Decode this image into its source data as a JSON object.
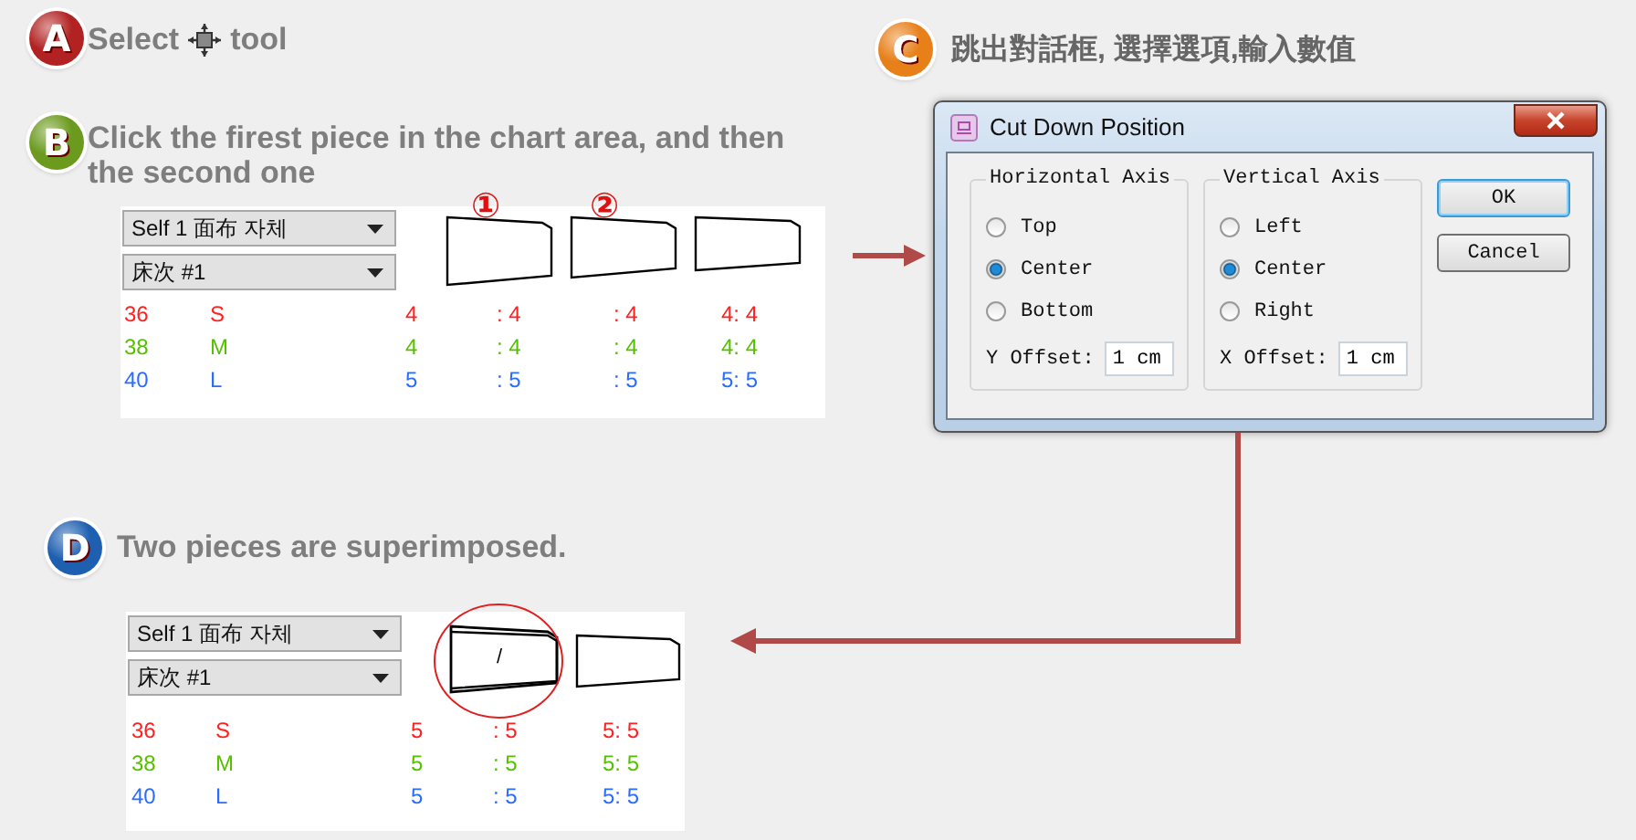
{
  "steps": [
    {
      "badge": "A",
      "color": "#b22222",
      "kind": "tool",
      "text_before": "Select",
      "text_after": "tool"
    },
    {
      "badge": "C",
      "color": "#e8801a",
      "kind": "text",
      "text": "跳出對話框, 選擇選項,輸入數值"
    },
    {
      "badge": "B",
      "color": "#6b9a1e",
      "kind": "text",
      "text": "Click the firest piece in the chart area, and then the second one"
    },
    {
      "badge": "D",
      "color": "#1f5fb0",
      "kind": "text",
      "text": "Two pieces are superimposed."
    }
  ],
  "markers": [
    "①",
    "②"
  ],
  "before_panel": {
    "dropdowns": [
      "Self 1 面布 자체",
      "床次 #1"
    ],
    "rows": [
      {
        "size": "36",
        "name": "S",
        "color": "#ff2020",
        "cells": [
          "4",
          ": 4",
          ": 4",
          "4: 4"
        ]
      },
      {
        "size": "38",
        "name": "M",
        "color": "#55c000",
        "cells": [
          "4",
          ": 4",
          ": 4",
          "4: 4"
        ]
      },
      {
        "size": "40",
        "name": "L",
        "color": "#2a6cff",
        "cells": [
          "5",
          ": 5",
          ": 5",
          "5: 5"
        ]
      }
    ]
  },
  "dialog": {
    "title": "Cut Down Position",
    "groups": [
      {
        "title": "Horizontal Axis",
        "options": [
          {
            "label": "Top",
            "selected": false
          },
          {
            "label": "Center",
            "selected": true
          },
          {
            "label": "Bottom",
            "selected": false
          }
        ],
        "offset_label": "Y Offset:",
        "offset_value": "1 cm"
      },
      {
        "title": "Vertical Axis",
        "options": [
          {
            "label": "Left",
            "selected": false
          },
          {
            "label": "Center",
            "selected": true
          },
          {
            "label": "Right",
            "selected": false
          }
        ],
        "offset_label": "X Offset:",
        "offset_value": "1 cm"
      }
    ],
    "buttons": [
      {
        "label": "OK",
        "default": true
      },
      {
        "label": "Cancel",
        "default": false
      }
    ]
  },
  "after_panel": {
    "dropdowns": [
      "Self 1 面布 자체",
      "床次 #1"
    ],
    "mark": "/",
    "rows": [
      {
        "size": "36",
        "name": "S",
        "color": "#ff2020",
        "cells": [
          "5",
          ": 5",
          "5: 5"
        ]
      },
      {
        "size": "38",
        "name": "M",
        "color": "#55c000",
        "cells": [
          "5",
          ": 5",
          "5: 5"
        ]
      },
      {
        "size": "40",
        "name": "L",
        "color": "#2a6cff",
        "cells": [
          "5",
          ": 5",
          "5: 5"
        ]
      }
    ]
  }
}
